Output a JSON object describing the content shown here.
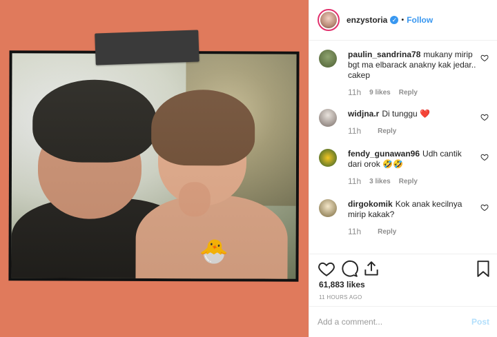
{
  "post": {
    "username": "enzystoria",
    "verified_icon": "verified-badge-icon",
    "separator": "•",
    "follow_label": "Follow"
  },
  "comments": [
    {
      "user": "paulin_sandrina78",
      "text": "mukany mirip bgt ma elbarack anakny kak jedar.. cakep",
      "time": "11h",
      "likes": "9 likes",
      "reply": "Reply"
    },
    {
      "user": "widjna.r",
      "text": "Di tunggu ❤️",
      "time": "11h",
      "likes": "",
      "reply": "Reply"
    },
    {
      "user": "fendy_gunawan96",
      "text": "Udh cantik dari orok 🤣🤣",
      "time": "11h",
      "likes": "3 likes",
      "reply": "Reply"
    },
    {
      "user": "dirgokomik",
      "text": "Kok anak kecilnya mirip kakak?",
      "time": "11h",
      "likes": "",
      "reply": "Reply"
    }
  ],
  "actions": {
    "like_icon": "heart-icon",
    "comment_icon": "comment-icon",
    "share_icon": "share-icon",
    "save_icon": "bookmark-icon"
  },
  "likes_count": "61,883 likes",
  "time_ago": "11 HOURS AGO",
  "add_comment": {
    "placeholder": "Add a comment...",
    "post_label": "Post"
  },
  "photo": {
    "sticker": "🐣"
  },
  "colors": {
    "background": "#e07a5c",
    "accent": "#3897f0",
    "verified": "#3897f0",
    "heart": "#ed4956"
  }
}
